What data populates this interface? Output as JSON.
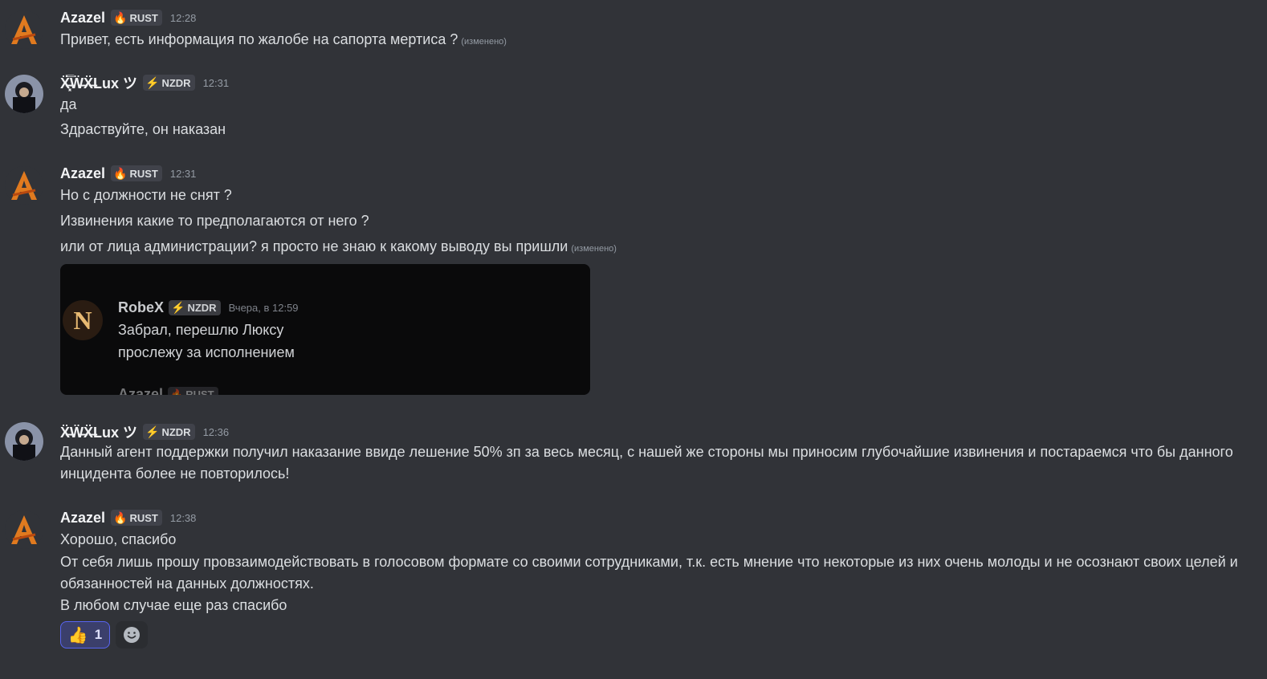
{
  "messages": [
    {
      "author": "Azazel",
      "tag": "RUST",
      "time": "12:28",
      "lines": [
        "Привет, есть информация по жалобе на сапорта мертиса ?"
      ],
      "edited_label": "(изменено)"
    },
    {
      "author": "X̵̸̶͇͈͉͓̿Luxツ",
      "author_display": "Ẍ̶͓̿Ẅ̶Ẍ̶Lux ツ",
      "tag": "NZDR",
      "time": "12:31",
      "lines": [
        "да",
        "Здраствуйте, он наказан"
      ]
    },
    {
      "author": "Azazel",
      "tag": "RUST",
      "time": "12:31",
      "lines": [
        "Но с должности не снят ?",
        "Извинения какие то предполагаются от него ?",
        "или от лица администрации? я просто не знаю к какому выводу вы пришли"
      ],
      "edited_label": "(изменено)",
      "attachment": {
        "author": "RobeX",
        "tag": "NZDR",
        "time": "Вчера, в 12:59",
        "lines": [
          "Забрал, перешлю Люксу",
          "прослежу за исполнением"
        ],
        "next_author": "Azazel",
        "next_tag": "RUST"
      }
    },
    {
      "author_display": "Ẍ̶Ẅ̶Ẍ̶Lux ツ",
      "tag": "NZDR",
      "time": "12:36",
      "text": "Данный агент поддержки получил наказание ввиде лешение 50% зп за весь месяц, с нашей же стороны мы приносим глубочайшие извинения и постараемся что бы данного инцидента более не повторилось!"
    },
    {
      "author": "Azazel",
      "tag": "RUST",
      "time": "12:38",
      "line1": "Хорошо, спасибо",
      "text": "От себя лишь прошу провзаимодействовать в голосовом формате со своими сотрудниками, т.к. есть мнение что некоторые из них очень молоды и не осознают своих целей и обязанностей на данных должностях.",
      "line3": "В любом случае еще раз спасибо",
      "reaction": {
        "emoji": "👍",
        "count": "1"
      }
    }
  ],
  "colors": {
    "background": "#313338",
    "text": "#dbdee1",
    "muted": "#949ba4",
    "reaction_accent": "#5865f2"
  },
  "icons": {
    "rust_tag": "flame-icon",
    "nzdr_tag": "lightning-icon",
    "add_reaction": "smile-icon"
  }
}
